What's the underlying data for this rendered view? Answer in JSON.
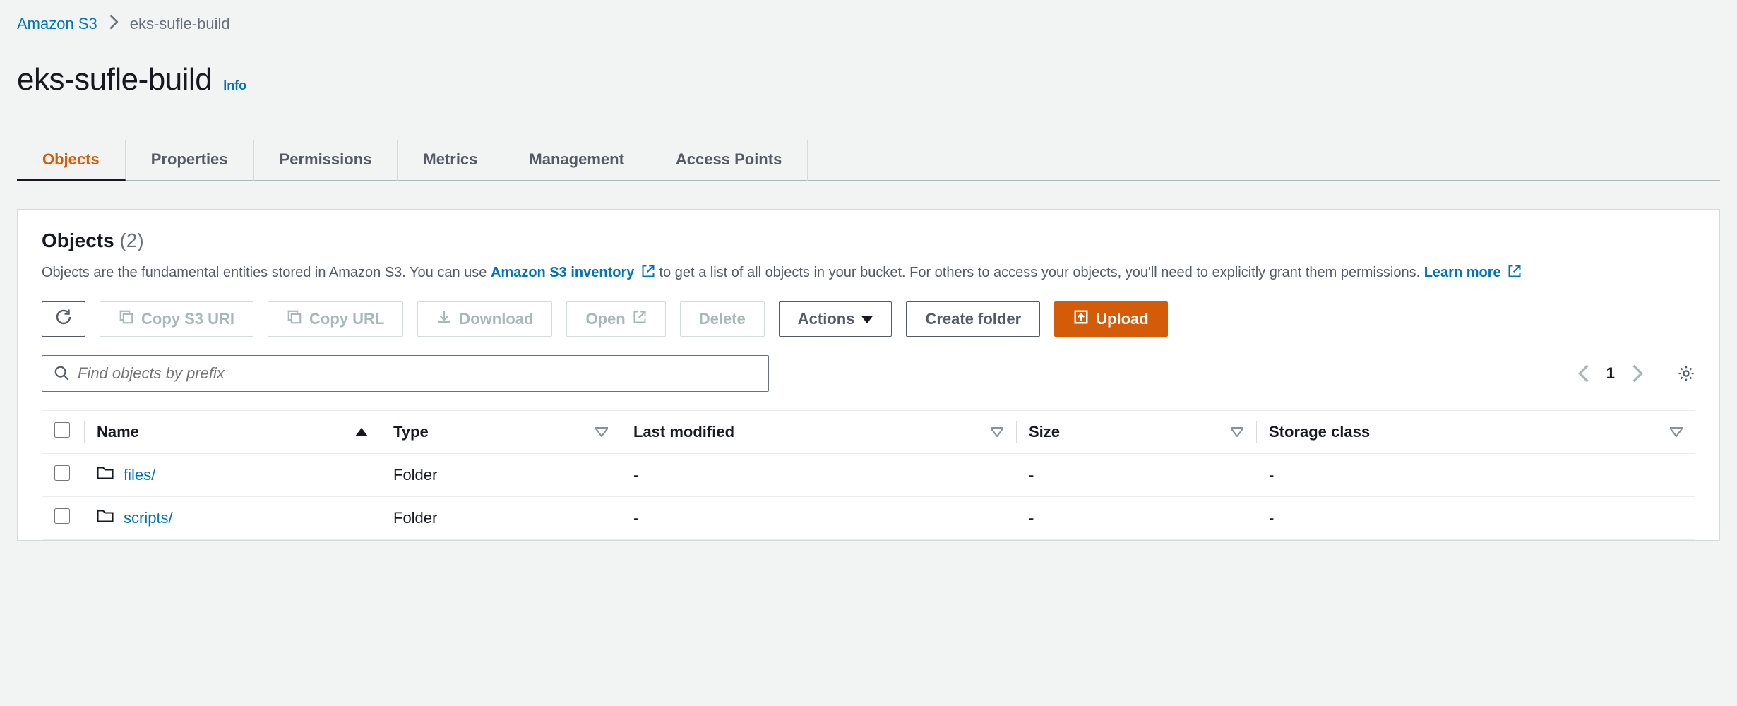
{
  "breadcrumb": {
    "root": "Amazon S3",
    "current": "eks-sufle-build"
  },
  "header": {
    "title": "eks-sufle-build",
    "info": "Info"
  },
  "tabs": [
    {
      "label": "Objects",
      "active": true
    },
    {
      "label": "Properties",
      "active": false
    },
    {
      "label": "Permissions",
      "active": false
    },
    {
      "label": "Metrics",
      "active": false
    },
    {
      "label": "Management",
      "active": false
    },
    {
      "label": "Access Points",
      "active": false
    }
  ],
  "panel": {
    "title": "Objects",
    "count": "(2)",
    "desc_a": "Objects are the fundamental entities stored in Amazon S3. You can use ",
    "inventory_link": "Amazon S3 inventory",
    "desc_b": " to get a list of all objects in your bucket. For others to access your objects, you'll need to explicitly grant them permissions. ",
    "learn_more": "Learn more"
  },
  "toolbar": {
    "copy_uri": "Copy S3 URI",
    "copy_url": "Copy URL",
    "download": "Download",
    "open": "Open",
    "delete": "Delete",
    "actions": "Actions",
    "create_folder": "Create folder",
    "upload": "Upload"
  },
  "search": {
    "placeholder": "Find objects by prefix"
  },
  "pager": {
    "page": "1"
  },
  "table": {
    "headers": {
      "name": "Name",
      "type": "Type",
      "last_modified": "Last modified",
      "size": "Size",
      "storage_class": "Storage class"
    },
    "rows": [
      {
        "name": "files/",
        "type": "Folder",
        "last_modified": "-",
        "size": "-",
        "storage_class": "-"
      },
      {
        "name": "scripts/",
        "type": "Folder",
        "last_modified": "-",
        "size": "-",
        "storage_class": "-"
      }
    ]
  }
}
